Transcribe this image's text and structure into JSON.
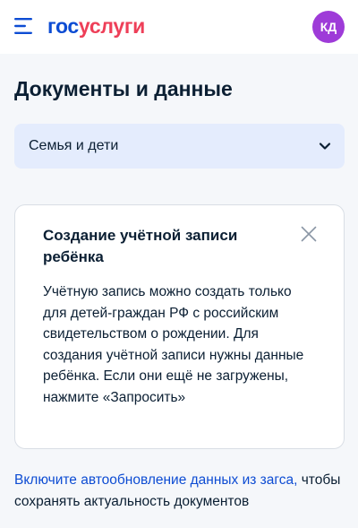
{
  "header": {
    "logo_part1": "гос",
    "logo_part2": "услуги",
    "avatar_initials": "КД"
  },
  "page": {
    "title": "Документы и данные"
  },
  "category_select": {
    "value": "Семья и дети"
  },
  "info_card": {
    "title": "Создание учётной записи ребёнка",
    "text": "Учётную запись можно создать только для детей-граждан РФ с российским свидетельством о рождении. Для создания учётной записи нужны данные ребёнка. Если они ещё не загружены, нажмите «Запросить»"
  },
  "footer": {
    "link_text": "Включите автообновление данных из загса,",
    "rest_text": " чтобы сохранять актуальность документов"
  },
  "colors": {
    "brand_blue": "#0d4cd3",
    "brand_red": "#ee3f58",
    "avatar_bg": "#9e3bd8",
    "select_bg": "#e4ecfd"
  },
  "icons": {
    "menu": "menu-icon",
    "chevron": "chevron-down-icon",
    "close": "close-icon"
  }
}
